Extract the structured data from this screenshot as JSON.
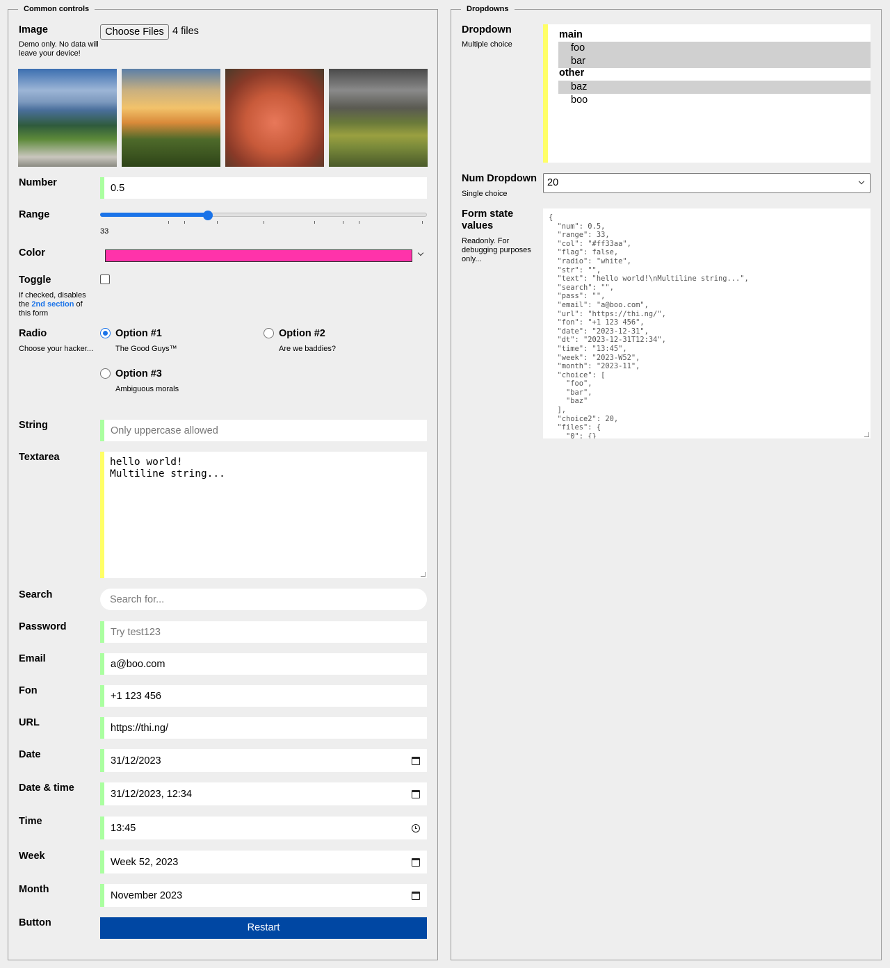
{
  "sections": {
    "common": "Common controls",
    "dropdowns": "Dropdowns"
  },
  "image": {
    "label": "Image",
    "desc": "Demo only. No data will leave your device!",
    "button": "Choose Files",
    "status": "4 files"
  },
  "number": {
    "label": "Number",
    "value": "0.5"
  },
  "range": {
    "label": "Range",
    "value": "33",
    "fraction": 0.33
  },
  "color": {
    "label": "Color",
    "value": "#ff33aa"
  },
  "toggle": {
    "label": "Toggle",
    "desc_pre": "If checked, disables the",
    "desc_link": "2nd section",
    "desc_post": "of this form"
  },
  "radio": {
    "label": "Radio",
    "desc": "Choose your hacker...",
    "options": [
      {
        "title": "Option #1",
        "desc": "The Good Guys™"
      },
      {
        "title": "Option #2",
        "desc": "Are we baddies?"
      },
      {
        "title": "Option #3",
        "desc": "Ambiguous morals"
      }
    ]
  },
  "string": {
    "label": "String",
    "placeholder": "Only uppercase allowed"
  },
  "textarea": {
    "label": "Textarea",
    "line1": "hello world!",
    "line2": "Multiline string..."
  },
  "search": {
    "label": "Search",
    "placeholder": "Search for..."
  },
  "password": {
    "label": "Password",
    "placeholder": "Try test123"
  },
  "email": {
    "label": "Email",
    "value": "a@boo.com"
  },
  "fon": {
    "label": "Fon",
    "value": "+1 123 456"
  },
  "url": {
    "label": "URL",
    "value": "https://thi.ng/"
  },
  "date": {
    "label": "Date",
    "value": "31/12/2023"
  },
  "datetime": {
    "label": "Date & time",
    "value": "31/12/2023, 12:34"
  },
  "time": {
    "label": "Time",
    "value": "13:45"
  },
  "week": {
    "label": "Week",
    "value": "Week 52, 2023"
  },
  "month": {
    "label": "Month",
    "value": "November 2023"
  },
  "button": {
    "label": "Button",
    "text": "Restart"
  },
  "dropdown": {
    "label": "Dropdown",
    "desc": "Multiple choice",
    "groups": [
      {
        "name": "main",
        "options": [
          {
            "text": "foo",
            "selected": true
          },
          {
            "text": "bar",
            "selected": true
          }
        ]
      },
      {
        "name": "other",
        "options": [
          {
            "text": "baz",
            "selected": true
          },
          {
            "text": "boo",
            "selected": false
          }
        ]
      }
    ]
  },
  "numdropdown": {
    "label": "Num Dropdown",
    "desc": "Single choice",
    "value": "20"
  },
  "formstate": {
    "label": "Form state values",
    "desc": "Readonly. For debugging purposes only...",
    "json": "{\n  \"num\": 0.5,\n  \"range\": 33,\n  \"col\": \"#ff33aa\",\n  \"flag\": false,\n  \"radio\": \"white\",\n  \"str\": \"\",\n  \"text\": \"hello world!\\nMultiline string...\",\n  \"search\": \"\",\n  \"pass\": \"\",\n  \"email\": \"a@boo.com\",\n  \"url\": \"https://thi.ng/\",\n  \"fon\": \"+1 123 456\",\n  \"date\": \"2023-12-31\",\n  \"dt\": \"2023-12-31T12:34\",\n  \"time\": \"13:45\",\n  \"week\": \"2023-W52\",\n  \"month\": \"2023-11\",\n  \"choice\": [\n    \"foo\",\n    \"bar\",\n    \"baz\"\n  ],\n  \"choice2\": 20,\n  \"files\": {\n    \"0\": {}"
  },
  "colors": {
    "accent": "#1a73e8",
    "valid_marker": "#aaffa0",
    "highlight_marker": "#ffff66",
    "button_bg": "#0047a3",
    "link": "#1a73e8"
  }
}
